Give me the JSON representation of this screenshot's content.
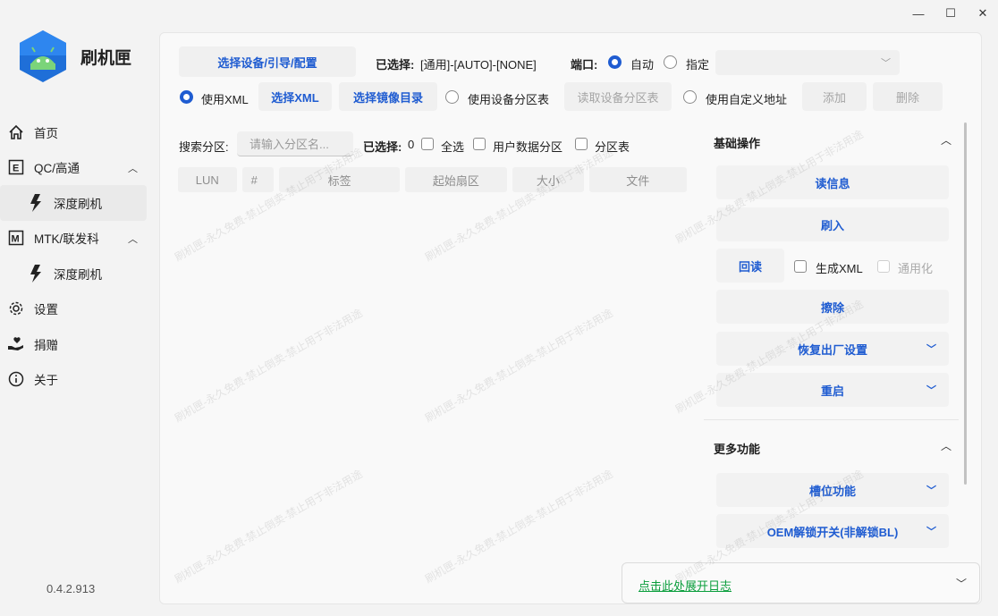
{
  "app": {
    "name": "刷机匣",
    "version": "0.4.2.913"
  },
  "window_controls": {
    "minimize": "—",
    "maximize": "☐",
    "close": "✕"
  },
  "sidebar": {
    "items": [
      {
        "label": "首页",
        "icon": "home-icon"
      },
      {
        "label": "QC/高通",
        "icon": "letter-e-icon",
        "expanded": true
      },
      {
        "label": "深度刷机",
        "icon": "lightning-icon",
        "sub": true,
        "active": true
      },
      {
        "label": "MTK/联发科",
        "icon": "letter-m-icon",
        "expanded": true
      },
      {
        "label": "深度刷机",
        "icon": "lightning-icon",
        "sub": true
      },
      {
        "label": "设置",
        "icon": "gear-icon"
      },
      {
        "label": "捐赠",
        "icon": "donate-icon"
      },
      {
        "label": "关于",
        "icon": "info-icon"
      }
    ]
  },
  "toolbar": {
    "select_device_button": "选择设备/引导/配置",
    "selected_label": "已选择:",
    "selected_value": "[通用]-[AUTO]-[NONE]",
    "port_label": "端口:",
    "port_auto": "自动",
    "port_manual": "指定"
  },
  "row2": {
    "use_xml": "使用XML",
    "select_xml": "选择XML",
    "select_image_dir": "选择镜像目录",
    "use_device_partition": "使用设备分区表",
    "read_device_partition": "读取设备分区表",
    "use_custom_address": "使用自定义地址",
    "add": "添加",
    "delete": "删除"
  },
  "search": {
    "label": "搜索分区:",
    "placeholder": "请输入分区名...",
    "selected_label": "已选择:",
    "selected_count": "0",
    "select_all": "全选",
    "user_data_partition": "用户数据分区",
    "partition_table": "分区表"
  },
  "table": {
    "columns": [
      "LUN",
      "#",
      "标签",
      "起始扇区",
      "大小",
      "文件"
    ]
  },
  "basic_ops": {
    "title": "基础操作",
    "read_info": "读信息",
    "flash": "刷入",
    "readback": "回读",
    "generate_xml": "生成XML",
    "generic": "通用化",
    "erase": "擦除",
    "factory_reset": "恢复出厂设置",
    "reboot": "重启"
  },
  "more_funcs": {
    "title": "更多功能",
    "slot_func": "槽位功能",
    "oem_unlock": "OEM解锁开关(非解锁BL)"
  },
  "log": {
    "expand_text": "点击此处展开日志"
  },
  "watermark_text": "刷机匣-永久免费-禁止倒卖-禁止用于非法用途"
}
